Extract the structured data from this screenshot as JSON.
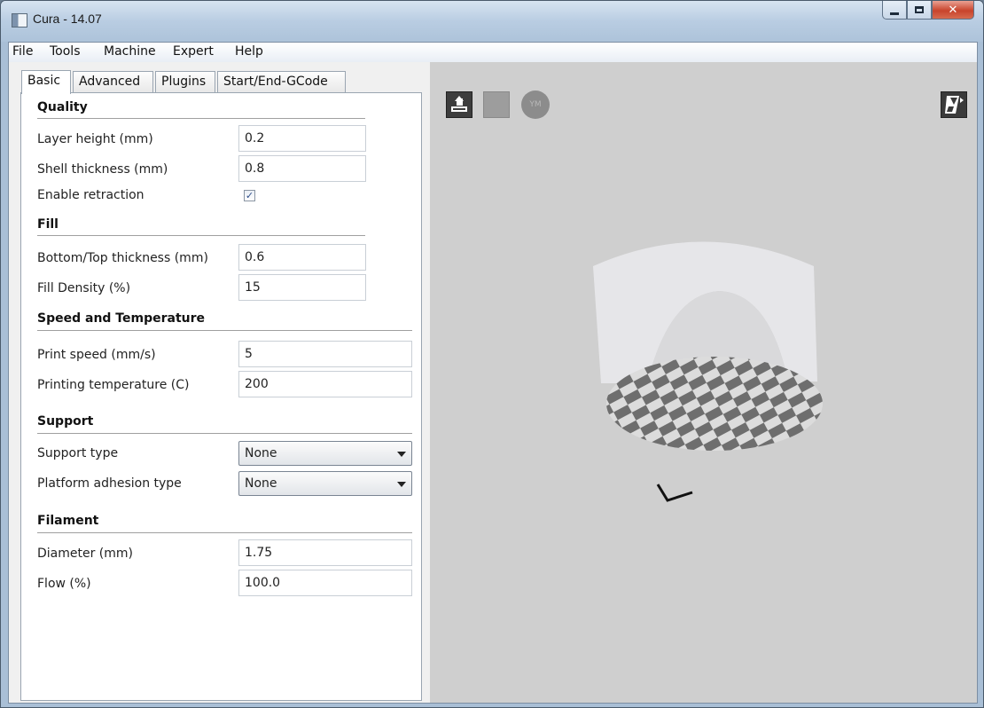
{
  "window": {
    "title": "Cura - 14.07"
  },
  "menu": [
    "File",
    "Tools",
    "Machine",
    "Expert",
    "Help"
  ],
  "tabs": [
    "Basic",
    "Advanced",
    "Plugins",
    "Start/End-GCode"
  ],
  "active_tab": "Basic",
  "sections": {
    "quality": {
      "title": "Quality",
      "layer_height": {
        "label": "Layer height (mm)",
        "value": "0.2"
      },
      "shell_thickness": {
        "label": "Shell thickness (mm)",
        "value": "0.8"
      },
      "enable_retraction": {
        "label": "Enable retraction",
        "checked": true
      }
    },
    "fill": {
      "title": "Fill",
      "bottom_top": {
        "label": "Bottom/Top thickness (mm)",
        "value": "0.6"
      },
      "fill_density": {
        "label": "Fill Density (%)",
        "value": "15"
      }
    },
    "speed": {
      "title": "Speed and Temperature",
      "print_speed": {
        "label": "Print speed (mm/s)",
        "value": "5"
      },
      "print_temp": {
        "label": "Printing temperature (C)",
        "value": "200"
      }
    },
    "support": {
      "title": "Support",
      "support_type": {
        "label": "Support type",
        "value": "None"
      },
      "adhesion_type": {
        "label": "Platform adhesion type",
        "value": "None"
      }
    },
    "filament": {
      "title": "Filament",
      "diameter": {
        "label": "Diameter (mm)",
        "value": "1.75"
      },
      "flow": {
        "label": "Flow (%)",
        "value": "100.0"
      }
    }
  },
  "toolbar": {
    "load_icon": "load-model-icon",
    "disabled_label": "",
    "ym_label": "YM",
    "view_icon": "view-mode-icon"
  },
  "colors": {
    "viewport_bg": "#cfcfcf",
    "model": "#e8e8ec",
    "checker_dark": "#6e6e6e",
    "checker_light": "#dcdcdc"
  }
}
